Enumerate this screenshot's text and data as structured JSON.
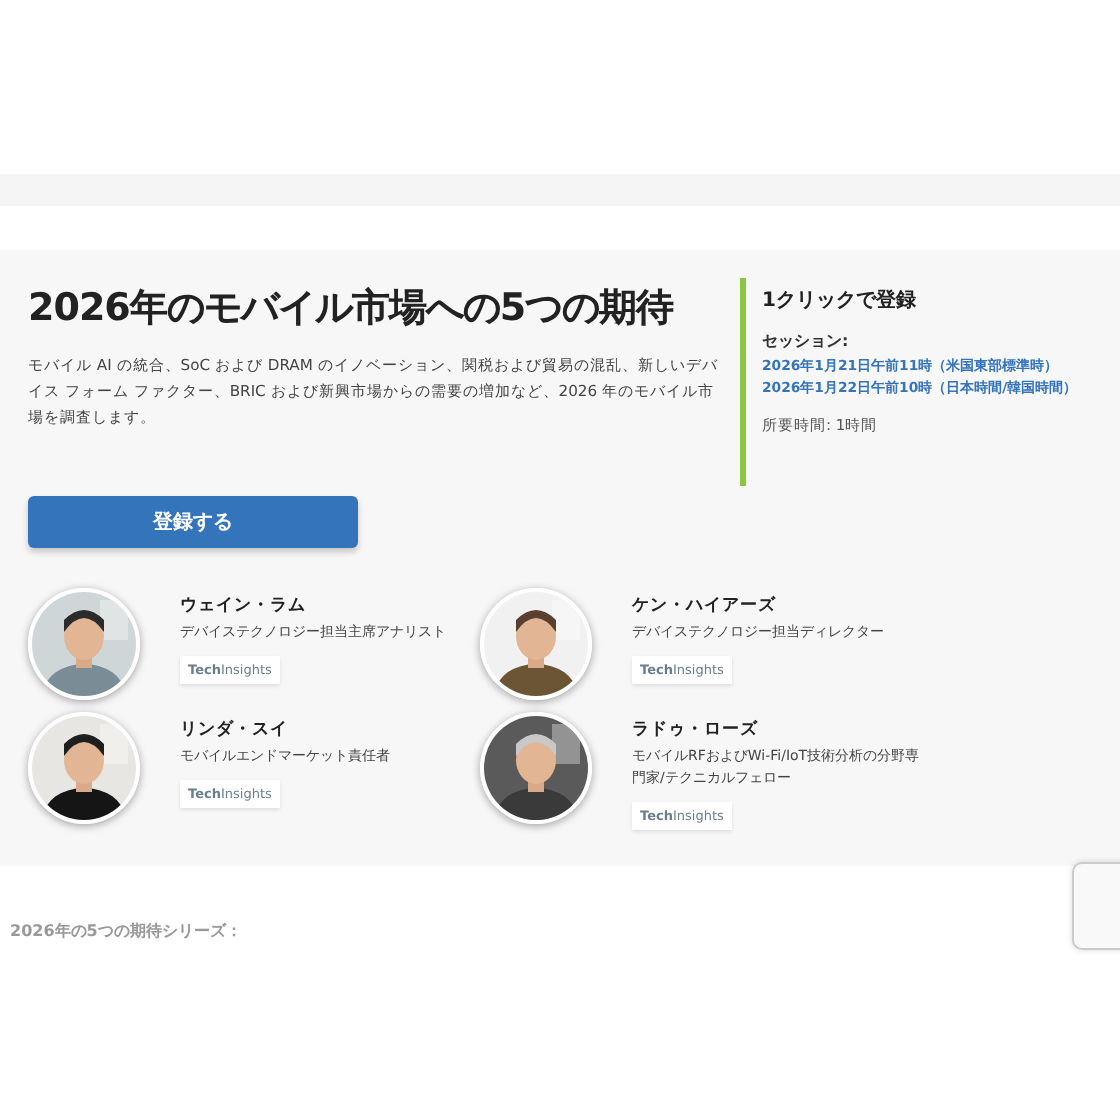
{
  "event": {
    "title": "2026年のモバイル市場への5つの期待",
    "description": "モバイル AI の統合、SoC および DRAM のイノベーション、関税および貿易の混乱、新しいデバイス フォーム ファクター、BRIC および新興市場からの需要の増加など、2026 年のモバイル市場を調査します。",
    "register_button": "登録する"
  },
  "registration": {
    "heading": "1クリックで登録",
    "sessions_label": "セッション:",
    "sessions": [
      "2026年1月21日午前11時（米国東部標準時）",
      "2026年1月22日午前10時（日本時間/韓国時間）"
    ],
    "duration": "所要時間: 1時間"
  },
  "speakers": [
    {
      "name": "ウェイン・ラム",
      "role": "デバイステクノロジー担当主席アナリスト",
      "company": "**Tech**Insights"
    },
    {
      "name": "ケン・ハイアーズ",
      "role": "デバイステクノロジー担当ディレクター",
      "company": "**Tech**Insights"
    },
    {
      "name": "リンダ・スイ",
      "role": "モバイルエンドマーケット責任者",
      "company": "**Tech**Insights"
    },
    {
      "name": "ラドゥ・ローズ",
      "role": "モバイルRFおよびWi-Fi/IoT技術分析の分野専門家/テクニカルフェロー",
      "company": "**Tech**Insights"
    }
  ],
  "series_heading": "2026年の5つの期待シリーズ："
}
